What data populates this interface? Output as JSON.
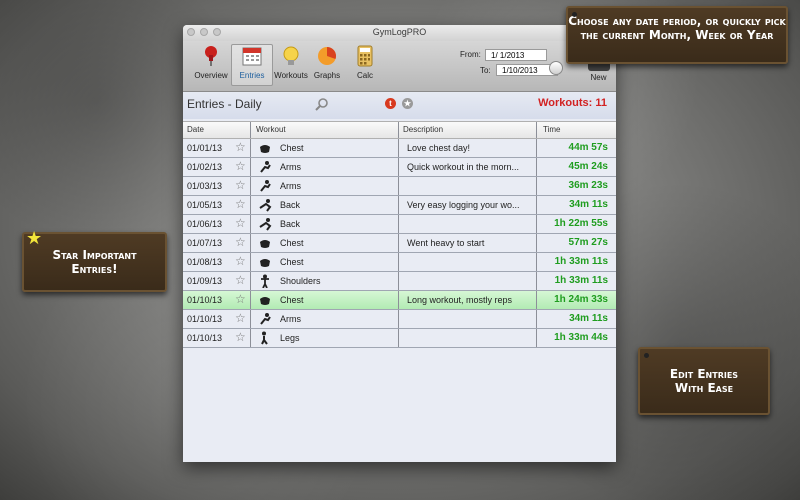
{
  "app": {
    "title": "GymLogPRO"
  },
  "toolbar": {
    "items": [
      {
        "label": "Overview",
        "icon": "pushpin-icon"
      },
      {
        "label": "Entries",
        "icon": "calendar-icon"
      },
      {
        "label": "Workouts",
        "icon": "lightbulb-icon"
      },
      {
        "label": "Graphs",
        "icon": "pie-chart-icon"
      },
      {
        "label": "Calc",
        "icon": "calculator-icon"
      }
    ],
    "from_label": "From:",
    "from_value": "1/  1/2013",
    "to_label": "To:",
    "to_value": "1/10/2013",
    "new_label": "New"
  },
  "header": {
    "title": "Entries - Daily",
    "workouts_label": "Workouts: 11",
    "badge_red": "t",
    "badge_gray": "★"
  },
  "table": {
    "columns": [
      "Date",
      "Workout",
      "Description",
      "Time"
    ],
    "rows": [
      {
        "date": "01/01/13",
        "workout": "Chest",
        "description": "Love chest day!",
        "time": "44m 57s"
      },
      {
        "date": "01/02/13",
        "workout": "Arms",
        "description": "Quick workout in the morn...",
        "time": "45m 24s"
      },
      {
        "date": "01/03/13",
        "workout": "Arms",
        "description": "",
        "time": "36m 23s"
      },
      {
        "date": "01/05/13",
        "workout": "Back",
        "description": "Very easy logging your wo...",
        "time": "34m 11s"
      },
      {
        "date": "01/06/13",
        "workout": "Back",
        "description": "",
        "time": "1h 22m 55s"
      },
      {
        "date": "01/07/13",
        "workout": "Chest",
        "description": "Went heavy to start",
        "time": "57m 27s"
      },
      {
        "date": "01/08/13",
        "workout": "Chest",
        "description": "",
        "time": "1h 33m 11s"
      },
      {
        "date": "01/09/13",
        "workout": "Shoulders",
        "description": "",
        "time": "1h 33m 11s"
      },
      {
        "date": "01/10/13",
        "workout": "Chest",
        "description": "Long workout, mostly reps",
        "time": "1h 24m 33s"
      },
      {
        "date": "01/10/13",
        "workout": "Arms",
        "description": "",
        "time": "34m 11s"
      },
      {
        "date": "01/10/13",
        "workout": "Legs",
        "description": "",
        "time": "1h 33m 44s"
      }
    ],
    "selected_row": 8
  },
  "callouts": {
    "date": "Choose any date period, or quickly pick the current Month, Week or Year",
    "star": "Star Important Entries!",
    "edit": "Edit Entries With Ease"
  },
  "colors": {
    "time": "#1f9d1f",
    "workouts": "#d22222",
    "selected": "#b2ebb3",
    "callout": "#3f2f1d"
  }
}
